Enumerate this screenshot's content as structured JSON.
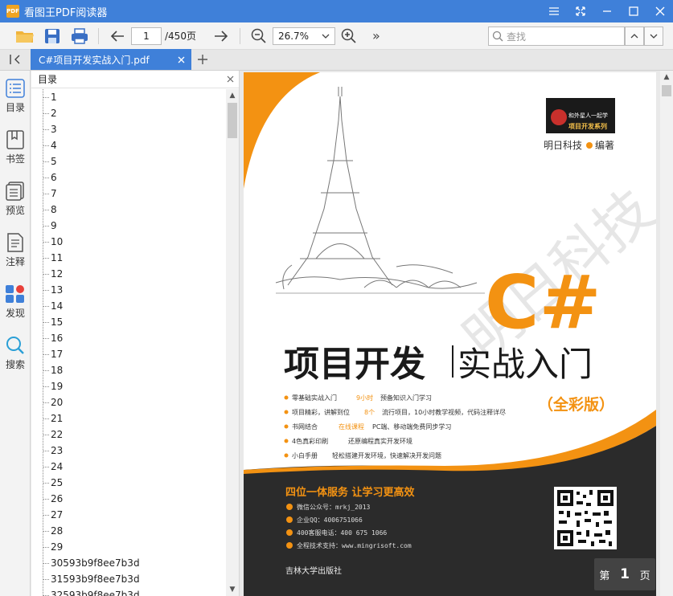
{
  "window": {
    "app_title": "看图王PDF阅读器",
    "app_icon_text": "PDF"
  },
  "toolbar": {
    "current_page": "1",
    "total_pages": "/450页",
    "zoom": "26.7%",
    "search_placeholder": "查找",
    "more": "»"
  },
  "tabs": {
    "active_label": "C#项目开发实战入门.pdf"
  },
  "leftnav": [
    {
      "label": "目录"
    },
    {
      "label": "书签"
    },
    {
      "label": "预览"
    },
    {
      "label": "注释"
    },
    {
      "label": "发现"
    },
    {
      "label": "搜索"
    }
  ],
  "outline": {
    "title": "目录",
    "items": [
      "1",
      "2",
      "3",
      "4",
      "5",
      "6",
      "7",
      "8",
      "9",
      "10",
      "11",
      "12",
      "13",
      "14",
      "15",
      "16",
      "17",
      "18",
      "19",
      "20",
      "21",
      "22",
      "23",
      "24",
      "25",
      "26",
      "27",
      "28",
      "29",
      "30593b9f8ee7b3d",
      "31593b9f8ee7b3d",
      "32593b9f8ee7b3d"
    ]
  },
  "cover": {
    "series_badge": "和外星人一起学",
    "series_name": "项目开发系列",
    "publisher_line": "明日科技",
    "publisher_suffix": "编著",
    "big_title": "C#",
    "main_title_left": "项目开发",
    "main_title_right": "实战入门",
    "edition": "（全彩版）",
    "watermark": "明日科技",
    "bullets": [
      {
        "lead": "零基础实战入门",
        "hl": "9小时",
        "tail": "预备知识入门学习"
      },
      {
        "lead": "项目精彩，讲解到位",
        "hl": "8个",
        "tail": "流行项目，10小时教学视频，代码注释详尽"
      },
      {
        "lead": "书网结合",
        "hl": "在线课程",
        "tail": "PC端、移动端免费同步学习"
      },
      {
        "lead": "4色真彩印刷",
        "hl": "",
        "tail": "还原编程真实开发环境"
      },
      {
        "lead": "小白手册",
        "hl": "",
        "tail": "轻松搭建开发环境，快速解决开发问题"
      }
    ],
    "service_title": "四位一体服务  让学习更高效",
    "service_lines": [
      "微信公众号：mrkj_2013",
      "企业QQ：4006751066",
      "400客服电话：400 675 1066",
      "全程技术支持：www.mingrisoft.com"
    ],
    "press": "吉林大学出版社"
  },
  "page_indicator": {
    "prefix": "第",
    "number": "1",
    "suffix": "页"
  },
  "colors": {
    "accent_blue": "#3f80d9",
    "orange": "#f39212",
    "cover_dark": "#2a2a2a"
  }
}
